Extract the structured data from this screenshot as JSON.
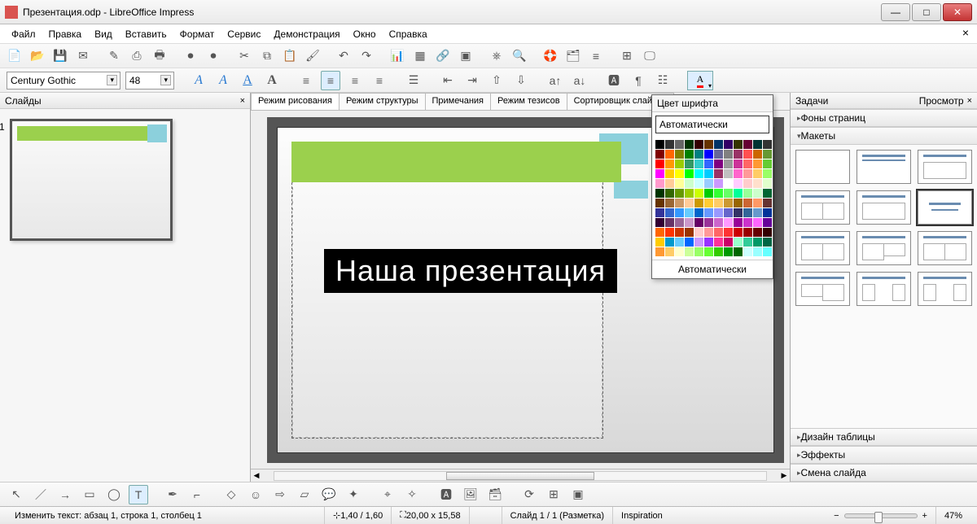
{
  "window": {
    "title": "Презентация.odp - LibreOffice Impress"
  },
  "menu": [
    "Файл",
    "Правка",
    "Вид",
    "Вставить",
    "Формат",
    "Сервис",
    "Демонстрация",
    "Окно",
    "Справка"
  ],
  "font": {
    "name": "Century Gothic",
    "size": "48"
  },
  "slides_panel": {
    "title": "Слайды",
    "thumb_number": "1"
  },
  "view_tabs": [
    "Режим рисования",
    "Режим структуры",
    "Примечания",
    "Режим тезисов",
    "Сортировщик слайдов"
  ],
  "slide": {
    "title_text": "Наша презентация"
  },
  "color_popup": {
    "header": "Цвет шрифта",
    "auto": "Автоматически",
    "auto_bottom": "Автоматически",
    "colors": [
      "#000000",
      "#333333",
      "#666666",
      "#003300",
      "#330000",
      "#663300",
      "#003366",
      "#330066",
      "#333300",
      "#660033",
      "#003333",
      "#333333",
      "#800000",
      "#ff6600",
      "#808000",
      "#008000",
      "#008080",
      "#0000ff",
      "#666699",
      "#808080",
      "#993366",
      "#ff5050",
      "#cc6600",
      "#669933",
      "#ff0000",
      "#ff9900",
      "#99cc00",
      "#339966",
      "#33cccc",
      "#3366ff",
      "#800080",
      "#999999",
      "#cc3399",
      "#ff6666",
      "#ff9933",
      "#66cc33",
      "#ff00ff",
      "#ffcc00",
      "#ffff00",
      "#00ff00",
      "#00ffff",
      "#00ccff",
      "#993366",
      "#c0c0c0",
      "#ff66cc",
      "#ff9999",
      "#ffcc66",
      "#99ff66",
      "#ff99cc",
      "#ffcc99",
      "#ffff99",
      "#ccffcc",
      "#ccffff",
      "#99ccff",
      "#cc99ff",
      "#ffffff",
      "#ffccff",
      "#ffcccc",
      "#ffe0cc",
      "#e0ffcc",
      "#003300",
      "#336600",
      "#669900",
      "#99cc00",
      "#ccff00",
      "#00cc00",
      "#33ff33",
      "#66ff66",
      "#00ff99",
      "#99ff99",
      "#ccffcc",
      "#006633",
      "#663300",
      "#996633",
      "#cc9966",
      "#ffcc99",
      "#cc9900",
      "#ffcc33",
      "#ffcc66",
      "#cc9933",
      "#996600",
      "#cc6633",
      "#ff9966",
      "#663333",
      "#333399",
      "#3366cc",
      "#3399ff",
      "#66ccff",
      "#0066cc",
      "#6699ff",
      "#9999ff",
      "#6666cc",
      "#333366",
      "#336699",
      "#6699cc",
      "#003399",
      "#330033",
      "#663366",
      "#996699",
      "#cc99cc",
      "#660066",
      "#993399",
      "#cc66cc",
      "#ff99ff",
      "#990099",
      "#cc33cc",
      "#ff66ff",
      "#660099",
      "#ff6600",
      "#ff3300",
      "#cc3300",
      "#993300",
      "#ffcccc",
      "#ff9999",
      "#ff6666",
      "#ff3333",
      "#cc0000",
      "#990000",
      "#660000",
      "#330000",
      "#ffcc00",
      "#0099cc",
      "#66ccff",
      "#0066ff",
      "#cc99ff",
      "#9933ff",
      "#ff3399",
      "#cc0066",
      "#99ffcc",
      "#33cc99",
      "#009966",
      "#006644",
      "#ff9933",
      "#ffcc66",
      "#ffffcc",
      "#ccff99",
      "#99ff66",
      "#66ff33",
      "#33cc00",
      "#009900",
      "#006600",
      "#ccffff",
      "#99ffff",
      "#66ffff"
    ]
  },
  "tasks_panel": {
    "title": "Задачи",
    "view": "Просмотр",
    "sections": {
      "bg": "Фоны страниц",
      "layouts": "Макеты",
      "table": "Дизайн таблицы",
      "effects": "Эффекты",
      "transition": "Смена слайда"
    }
  },
  "status": {
    "edit": "Изменить текст: абзац 1, строка 1, столбец 1",
    "pos": "1,40 / 1,60",
    "size": "20,00 x 15,58",
    "slide": "Слайд 1 / 1 (Разметка)",
    "template": "Inspiration",
    "zoom": "47%"
  }
}
